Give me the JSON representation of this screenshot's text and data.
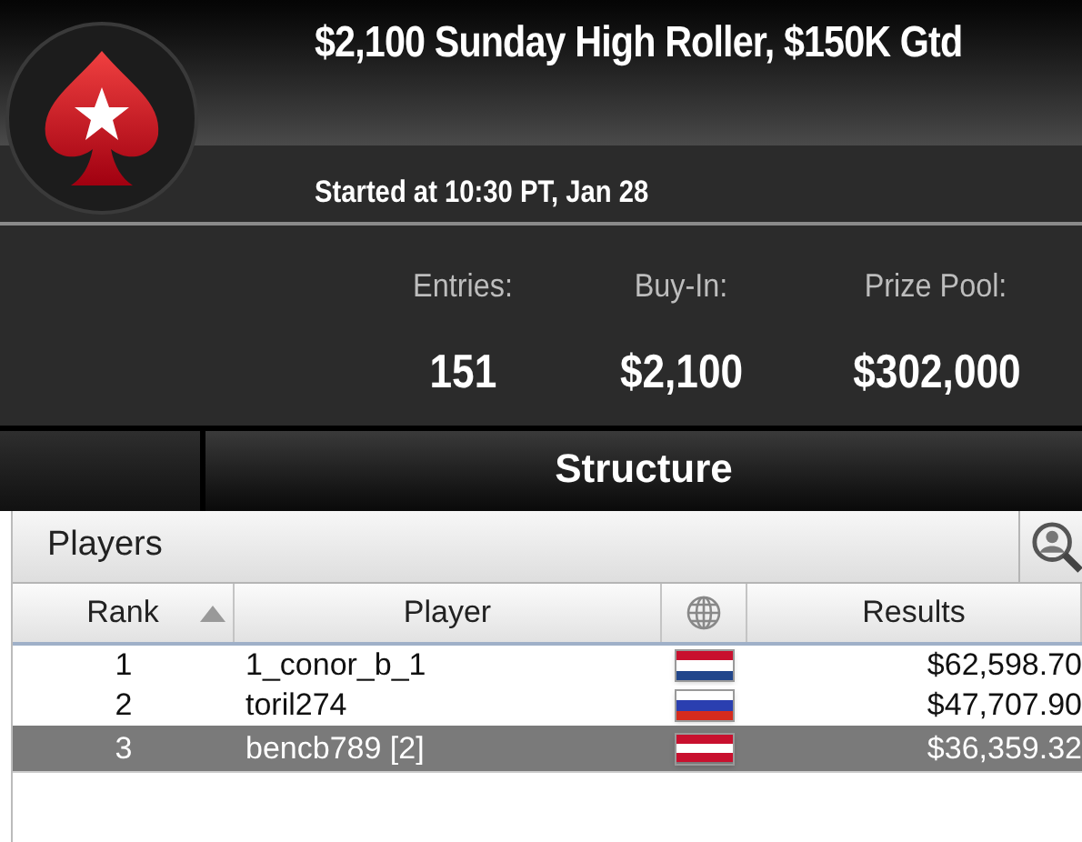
{
  "header": {
    "title": "$2,100 Sunday High Roller, $150K Gtd",
    "started": "Started at 10:30 PT, Jan 28"
  },
  "stats": [
    {
      "label": "Entries:",
      "value": "151"
    },
    {
      "label": "Buy-In:",
      "value": "$2,100"
    },
    {
      "label": "Prize Pool:",
      "value": "$302,000"
    }
  ],
  "tabs": [
    {
      "selected": false
    },
    {
      "label": "Structure",
      "selected": true
    }
  ],
  "players_panel": {
    "title": "Players"
  },
  "table": {
    "columns": [
      {
        "label": "Rank",
        "sorted": true
      },
      {
        "label": "Player",
        "sorted": false
      },
      {
        "kind": "globe",
        "sorted": false
      },
      {
        "label": "Results",
        "sorted": false
      }
    ],
    "rows": [
      {
        "rank": "1",
        "player": "1_conor_b_1",
        "kind": "rwb",
        "result": "$62,598.70",
        "selected": false
      },
      {
        "rank": "2",
        "player": "toril274",
        "kind": "wbr",
        "result": "$47,707.90",
        "selected": false
      },
      {
        "rank": "3",
        "player": "bencb789 [2]",
        "kind": "rwr",
        "result": "$36,359.32",
        "selected": true
      }
    ]
  }
}
